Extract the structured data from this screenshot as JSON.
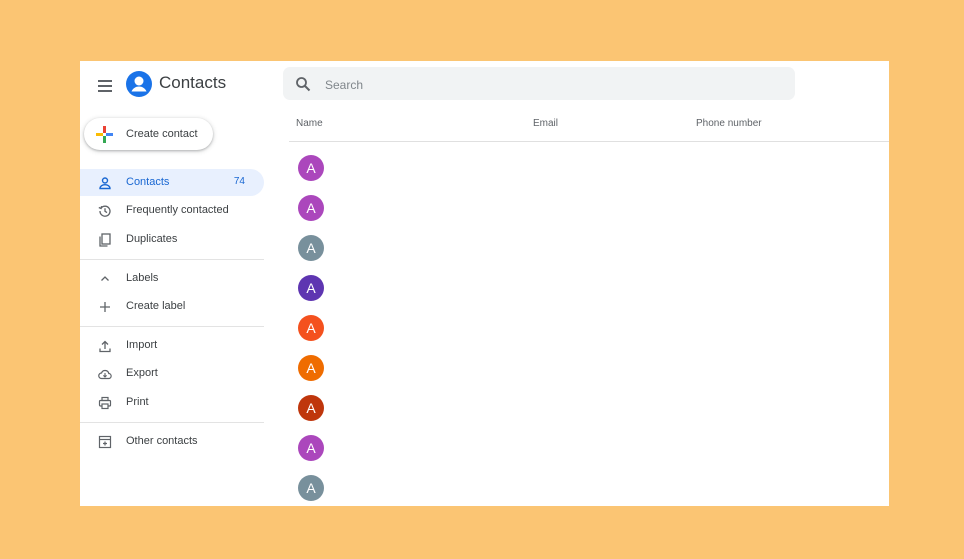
{
  "app": {
    "title": "Contacts",
    "logo_icon": "account-circle-icon",
    "menu_icon": "hamburger-menu-icon"
  },
  "search": {
    "placeholder": "Search",
    "value": "",
    "icon": "search-icon"
  },
  "create_contact": {
    "label": "Create contact",
    "icon": "multicolor-plus-icon"
  },
  "sidebar": {
    "items": [
      {
        "label": "Contacts",
        "count": "74",
        "icon": "person-icon",
        "active": true
      },
      {
        "label": "Frequently contacted",
        "icon": "history-icon"
      },
      {
        "label": "Duplicates",
        "icon": "copy-icon"
      }
    ],
    "labels_section": {
      "label": "Labels",
      "icon": "chevron-up-icon",
      "create_label": "Create label",
      "create_icon": "plus-icon"
    },
    "tools": [
      {
        "label": "Import",
        "icon": "upload-icon"
      },
      {
        "label": "Export",
        "icon": "cloud-download-icon"
      },
      {
        "label": "Print",
        "icon": "printer-icon"
      }
    ],
    "other_contacts": {
      "label": "Other contacts",
      "icon": "archive-add-icon"
    }
  },
  "table": {
    "columns": [
      "Name",
      "Email",
      "Phone number"
    ],
    "rows": [
      {
        "initial": "A",
        "color": "#ab47bc"
      },
      {
        "initial": "A",
        "color": "#ab47bc"
      },
      {
        "initial": "A",
        "color": "#78909c"
      },
      {
        "initial": "A",
        "color": "#5e35b1"
      },
      {
        "initial": "A",
        "color": "#f4511e"
      },
      {
        "initial": "A",
        "color": "#ef6c00"
      },
      {
        "initial": "A",
        "color": "#bf360c"
      },
      {
        "initial": "A",
        "color": "#ab47bc"
      },
      {
        "initial": "A",
        "color": "#78909c"
      }
    ]
  }
}
